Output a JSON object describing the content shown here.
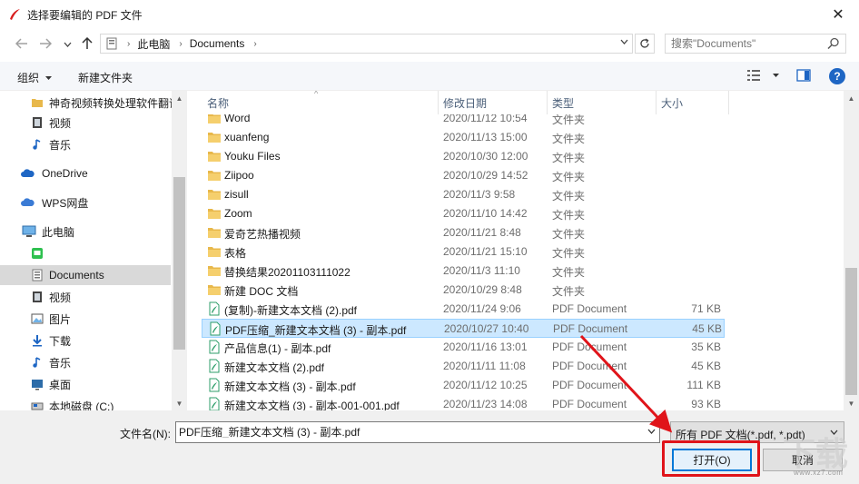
{
  "window": {
    "title": "选择要编辑的 PDF 文件",
    "close_symbol": "✕"
  },
  "address": {
    "breadcrumb": [
      "此电脑",
      "Documents"
    ],
    "search_placeholder": "搜索\"Documents\""
  },
  "toolbar": {
    "organize_label": "组织",
    "new_folder_label": "新建文件夹"
  },
  "nav": {
    "items": [
      {
        "label": "神奇视频转换处理软件翻译",
        "icon": "folder-icon"
      },
      {
        "label": "视频",
        "icon": "video-icon"
      },
      {
        "label": "音乐",
        "icon": "music-icon"
      },
      {
        "label": "OneDrive",
        "icon": "cloud-icon"
      },
      {
        "label": "WPS网盘",
        "icon": "wps-cloud-icon"
      },
      {
        "label": "此电脑",
        "icon": "computer-icon"
      },
      {
        "label": "",
        "icon": "app-icon-green"
      },
      {
        "label": "Documents",
        "icon": "documents-icon"
      },
      {
        "label": "视频",
        "icon": "video-icon"
      },
      {
        "label": "图片",
        "icon": "pictures-icon"
      },
      {
        "label": "下载",
        "icon": "download-icon"
      },
      {
        "label": "音乐",
        "icon": "music-icon"
      },
      {
        "label": "桌面",
        "icon": "desktop-icon"
      },
      {
        "label": "本地磁盘 (C:)",
        "icon": "drive-icon"
      }
    ]
  },
  "columns": {
    "name": "名称",
    "date": "修改日期",
    "type": "类型",
    "size": "大小"
  },
  "files": [
    {
      "name": "Word",
      "date": "2020/11/12 10:54",
      "type": "文件夹",
      "size": "",
      "kind": "folder"
    },
    {
      "name": "xuanfeng",
      "date": "2020/11/13 15:00",
      "type": "文件夹",
      "size": "",
      "kind": "folder"
    },
    {
      "name": "Youku Files",
      "date": "2020/10/30 12:00",
      "type": "文件夹",
      "size": "",
      "kind": "folder"
    },
    {
      "name": "Ziipoo",
      "date": "2020/10/29 14:52",
      "type": "文件夹",
      "size": "",
      "kind": "folder"
    },
    {
      "name": "zisull",
      "date": "2020/11/3 9:58",
      "type": "文件夹",
      "size": "",
      "kind": "folder"
    },
    {
      "name": "Zoom",
      "date": "2020/11/10 14:42",
      "type": "文件夹",
      "size": "",
      "kind": "folder"
    },
    {
      "name": "爱奇艺热播视频",
      "date": "2020/11/21 8:48",
      "type": "文件夹",
      "size": "",
      "kind": "folder"
    },
    {
      "name": "表格",
      "date": "2020/11/21 15:10",
      "type": "文件夹",
      "size": "",
      "kind": "folder"
    },
    {
      "name": "替换结果20201103111022",
      "date": "2020/11/3 11:10",
      "type": "文件夹",
      "size": "",
      "kind": "folder"
    },
    {
      "name": "新建 DOC 文档",
      "date": "2020/10/29 8:48",
      "type": "文件夹",
      "size": "",
      "kind": "folder"
    },
    {
      "name": "(复制)-新建文本文档 (2).pdf",
      "date": "2020/11/24 9:06",
      "type": "PDF Document",
      "size": "71 KB",
      "kind": "pdf"
    },
    {
      "name": "PDF压缩_新建文本文档 (3) - 副本.pdf",
      "date": "2020/10/27 10:40",
      "type": "PDF Document",
      "size": "45 KB",
      "kind": "pdf"
    },
    {
      "name": "产品信息(1) - 副本.pdf",
      "date": "2020/11/16 13:01",
      "type": "PDF Document",
      "size": "35 KB",
      "kind": "pdf"
    },
    {
      "name": "新建文本文档 (2).pdf",
      "date": "2020/11/11 11:08",
      "type": "PDF Document",
      "size": "45 KB",
      "kind": "pdf"
    },
    {
      "name": "新建文本文档 (3) - 副本.pdf",
      "date": "2020/11/12 10:25",
      "type": "PDF Document",
      "size": "111 KB",
      "kind": "pdf"
    },
    {
      "name": "新建文本文档 (3) - 副本-001-001.pdf",
      "date": "2020/11/23 14:08",
      "type": "PDF Document",
      "size": "93 KB",
      "kind": "pdf"
    }
  ],
  "footer": {
    "filename_label": "文件名(N):",
    "filename_value": "PDF压缩_新建文本文档 (3) - 副本.pdf",
    "filetype_value": "所有 PDF 文档(*.pdf, *.pdt)",
    "open_label": "打开(O)",
    "cancel_label": "取消"
  },
  "watermark": {
    "url": "www.xz7.com"
  },
  "colors": {
    "accent": "#0078d7",
    "selection": "#cce8ff",
    "annotation": "#e0141a",
    "folder": "#e8b84b",
    "pdf": "#2e9e6a"
  }
}
